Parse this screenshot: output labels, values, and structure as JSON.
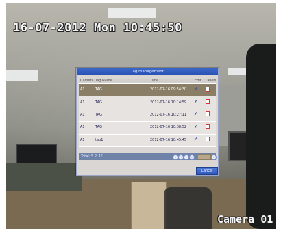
{
  "osd": {
    "timestamp": "16-07-2012 Mon 10:45:50",
    "camera_label": "Camera 01"
  },
  "dialog": {
    "title": "Tag management",
    "columns": {
      "camera": "Camera",
      "tag_name": "Tag Name",
      "time": "Time",
      "edit": "Edit",
      "delete": "Delete"
    },
    "rows": [
      {
        "camera": "A1",
        "tag_name": "TAG",
        "time": "2012-07-16 09:54:30",
        "selected": true
      },
      {
        "camera": "A1",
        "tag_name": "TAG",
        "time": "2012-07-16 10:14:59"
      },
      {
        "camera": "A1",
        "tag_name": "TAG",
        "time": "2012-07-16 10:27:11"
      },
      {
        "camera": "A1",
        "tag_name": "TAG",
        "time": "2012-07-16 10:38:52"
      },
      {
        "camera": "A1",
        "tag_name": "tag1",
        "time": "2012-07-16 10:45:45"
      }
    ],
    "footer": {
      "total": "Total: 5 P: 1/1",
      "nav": {
        "first": "«",
        "prev": "‹",
        "next": "›",
        "last": "»",
        "go": "›"
      }
    },
    "cancel_label": "Cancel"
  },
  "colors": {
    "titlebar": "#2a52b5",
    "selected_row": "#8a7f66",
    "footer": "#6f82a8"
  }
}
